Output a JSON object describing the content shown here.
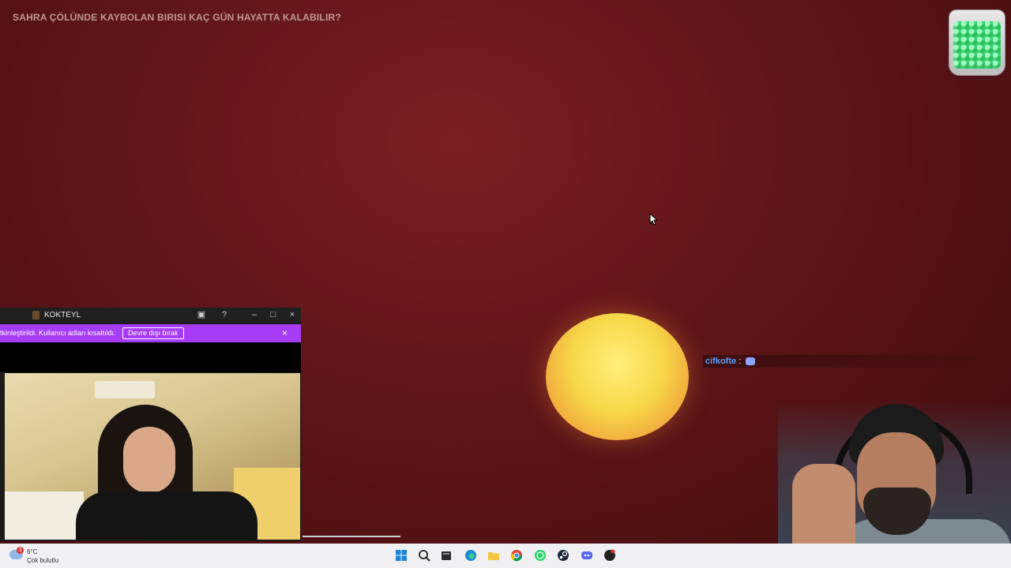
{
  "stream": {
    "question_title": "SAHRA ÇÖLÜNDE KAYBOLAN BIRISI KAÇ GÜN HAYATTA KALABILIR?"
  },
  "chat": {
    "username": "cifkofte",
    "separator": ":"
  },
  "kokteyl_window": {
    "app_name": "KOKTEYL",
    "banner_message": "tkinleştirildi. Kullanıcı adları kısaltıldı.",
    "banner_button": "Devre dışı bırak",
    "banner_close": "×",
    "controls": {
      "minimize": "–",
      "maximize": "□",
      "close": "×"
    }
  },
  "taskbar": {
    "weather_temp": "6°C",
    "weather_desc": "Çok bulutlu",
    "notification_count": "3",
    "pinned_icons": [
      "windows-start-icon",
      "search-icon",
      "file-explorer-dark-icon",
      "edge-icon",
      "folder-icon",
      "chrome-icon",
      "whatsapp-icon",
      "steam-icon",
      "discord-icon",
      "app-icon"
    ]
  },
  "colors": {
    "background": "#5e1518",
    "sun": "#f7d84a",
    "banner": "#a63cf5",
    "chat_username": "#5aa0ff"
  }
}
